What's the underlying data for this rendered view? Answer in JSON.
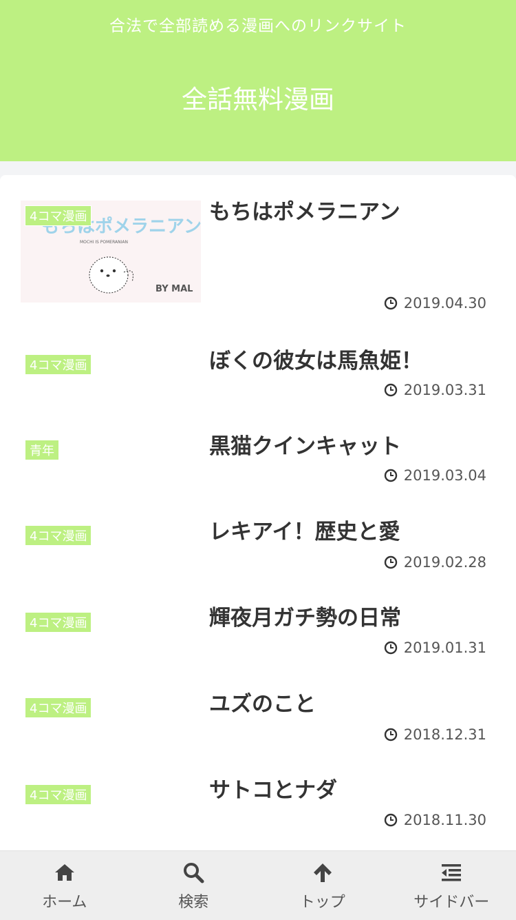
{
  "header": {
    "tagline": "合法で全部読める漫画へのリンクサイト",
    "site_title": "全話無料漫画",
    "color": "#bdf082"
  },
  "entries": [
    {
      "category": "4コマ漫画",
      "title": "もちはポメラニアン",
      "date": "2019.04.30",
      "thumbnail": {
        "logo": "もちはポメラニアン",
        "subtitle": "MOCHI IS POMERANIAN",
        "credit": "BY MAL"
      }
    },
    {
      "category": "4コマ漫画",
      "title": "ぼくの彼女は馬魚姫！",
      "date": "2019.03.31"
    },
    {
      "category": "青年",
      "title": "黒猫クインキャット",
      "date": "2019.03.04"
    },
    {
      "category": "4コマ漫画",
      "title": "レキアイ！歴史と愛",
      "date": "2019.02.28"
    },
    {
      "category": "4コマ漫画",
      "title": "輝夜月ガチ勢の日常",
      "date": "2019.01.31"
    },
    {
      "category": "4コマ漫画",
      "title": "ユズのこと",
      "date": "2018.12.31"
    },
    {
      "category": "4コマ漫画",
      "title": "サトコとナダ",
      "date": "2018.11.30"
    }
  ],
  "bottom_nav": [
    {
      "label": "ホーム",
      "icon": "home-icon"
    },
    {
      "label": "検索",
      "icon": "search-icon"
    },
    {
      "label": "トップ",
      "icon": "arrow-up-icon"
    },
    {
      "label": "サイドバー",
      "icon": "sidebar-icon"
    }
  ]
}
